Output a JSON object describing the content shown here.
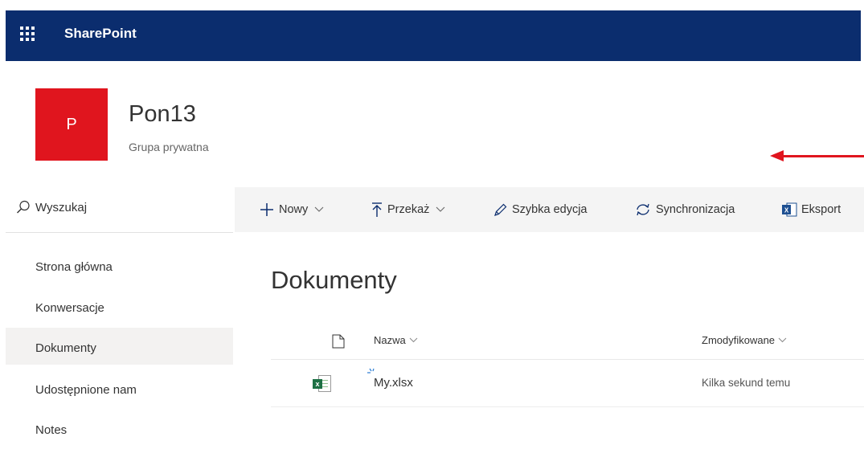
{
  "suite": {
    "brand": "SharePoint",
    "waffle_icon": "app-launcher-icon"
  },
  "site": {
    "logo_letter": "P",
    "logo_color": "#e0151e",
    "title": "Pon13",
    "subtitle": "Grupa prywatna"
  },
  "nav": {
    "search_label": "Wyszukaj",
    "items": [
      {
        "label": "Strona główna",
        "selected": false
      },
      {
        "label": "Konwersacje",
        "selected": false
      },
      {
        "label": "Dokumenty",
        "selected": true
      },
      {
        "label": "Udostępnione nam",
        "selected": false
      },
      {
        "label": "Notes",
        "selected": false
      }
    ]
  },
  "commands": {
    "new": "Nowy",
    "upload": "Przekaż",
    "quick_edit": "Szybka edycja",
    "sync": "Synchronizacja",
    "export": "Eksport"
  },
  "library": {
    "title": "Dokumenty",
    "columns": {
      "name": "Nazwa",
      "modified": "Zmodyfikowane"
    },
    "files": [
      {
        "name": "My.xlsx",
        "modified": "Kilka sekund temu",
        "type": "excel",
        "is_new": true
      }
    ]
  },
  "colors": {
    "suitebar": "#0b2d6e",
    "annotation_arrow": "#e0151e"
  }
}
